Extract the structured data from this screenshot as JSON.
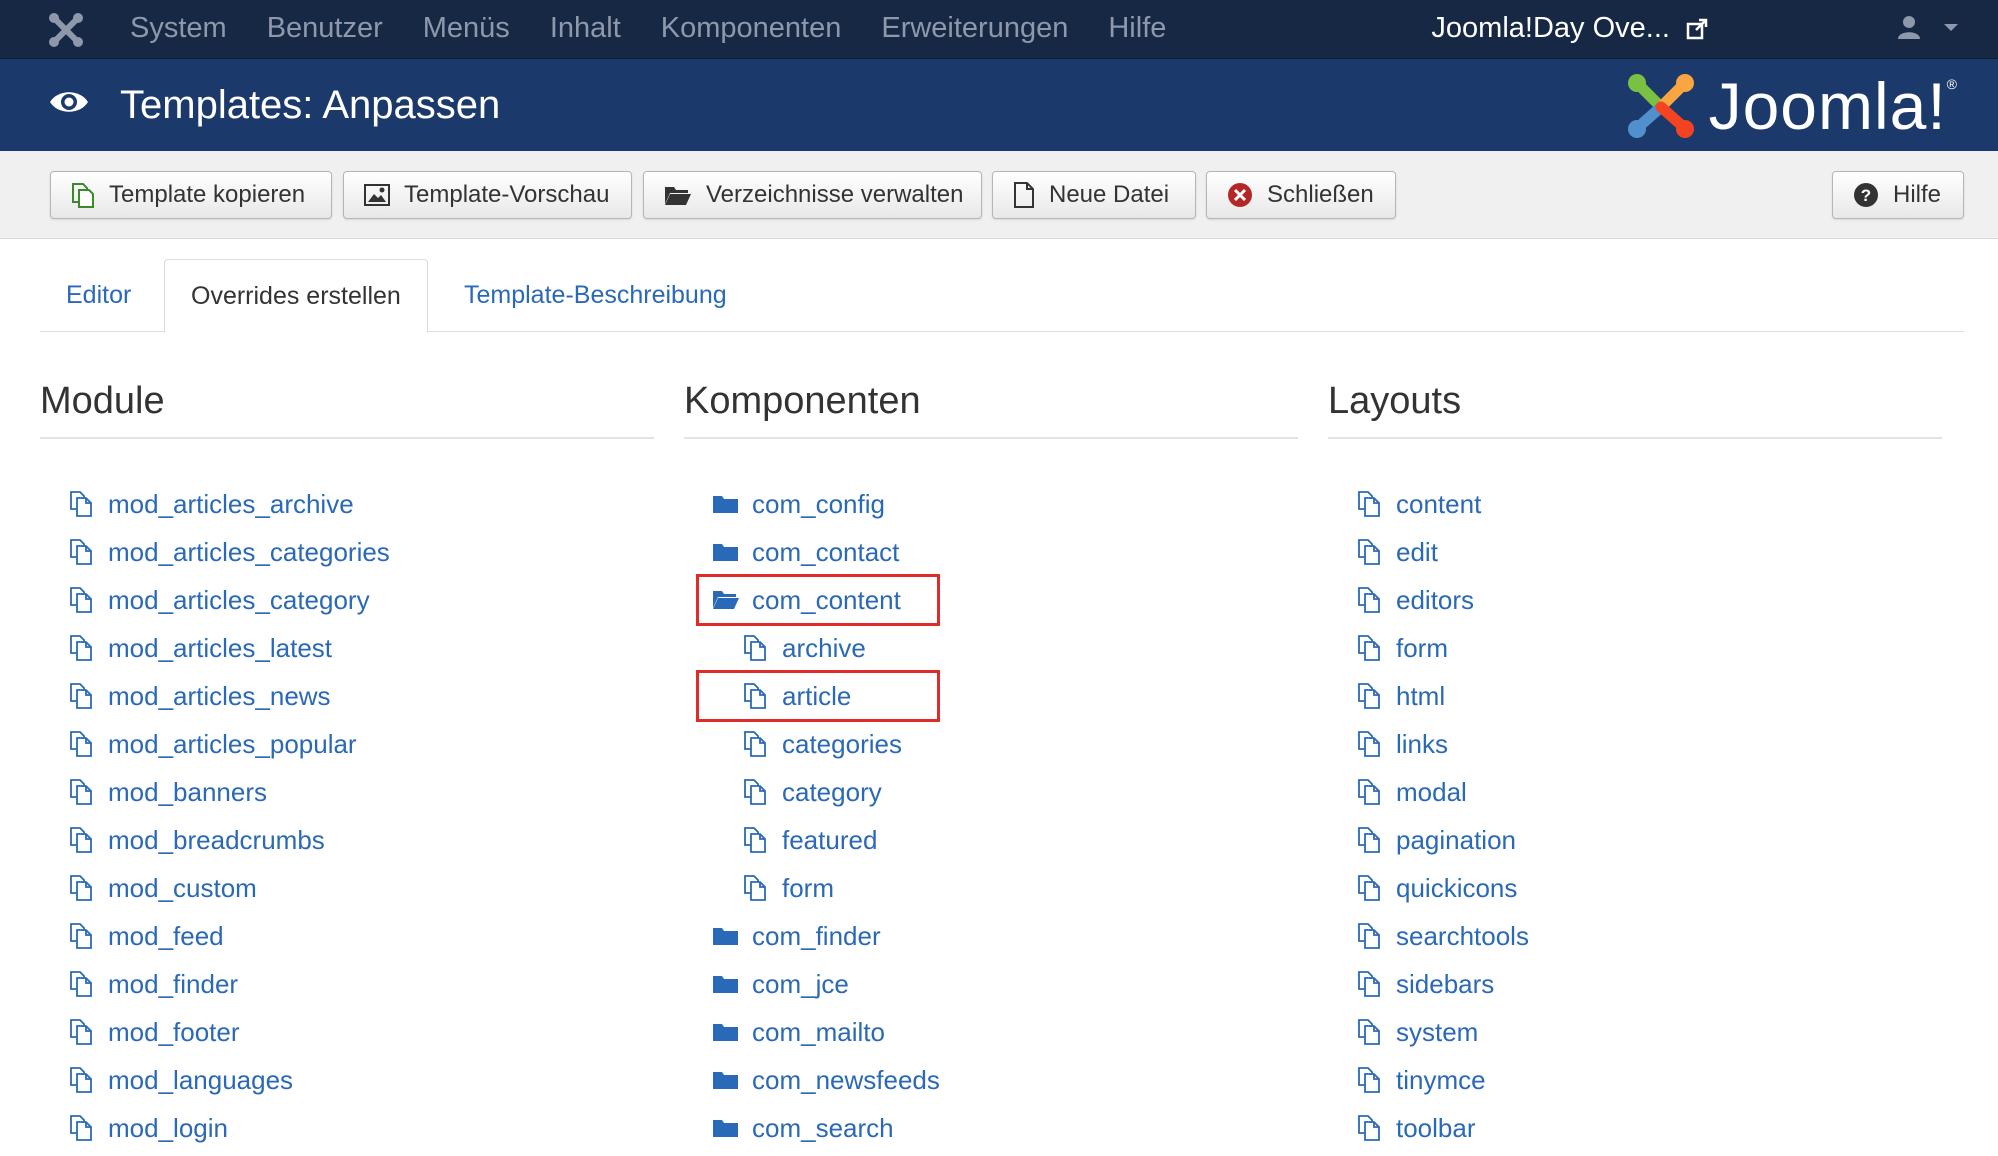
{
  "navbar": {
    "brand_icon": "joomla-icon",
    "menu": [
      "System",
      "Benutzer",
      "Menüs",
      "Inhalt",
      "Komponenten",
      "Erweiterungen",
      "Hilfe"
    ],
    "site_link": "Joomla!Day Ove...",
    "site_link_icon": "external-link-icon",
    "user_icon": "user-icon"
  },
  "header": {
    "title": "Templates: Anpassen",
    "icon": "eye-icon",
    "logo_text": "Joomla!",
    "logo_mark": "®"
  },
  "toolbar": {
    "copy": "Template kopieren",
    "preview": "Template-Vorschau",
    "folders": "Verzeichnisse verwalten",
    "new_file": "Neue Datei",
    "close": "Schließen",
    "help": "Hilfe"
  },
  "tabs": [
    "Editor",
    "Overrides erstellen",
    "Template-Beschreibung"
  ],
  "active_tab": "Overrides erstellen",
  "modules": {
    "title": "Module",
    "items": [
      "mod_articles_archive",
      "mod_articles_categories",
      "mod_articles_category",
      "mod_articles_latest",
      "mod_articles_news",
      "mod_articles_popular",
      "mod_banners",
      "mod_breadcrumbs",
      "mod_custom",
      "mod_feed",
      "mod_finder",
      "mod_footer",
      "mod_languages",
      "mod_login"
    ]
  },
  "components": {
    "title": "Komponenten",
    "items": [
      {
        "label": "com_config",
        "type": "folder"
      },
      {
        "label": "com_contact",
        "type": "folder"
      },
      {
        "label": "com_content",
        "type": "folder-open",
        "highlighted": true
      },
      {
        "label": "archive",
        "type": "file",
        "sub": true
      },
      {
        "label": "article",
        "type": "file",
        "sub": true,
        "highlighted": true
      },
      {
        "label": "categories",
        "type": "file",
        "sub": true
      },
      {
        "label": "category",
        "type": "file",
        "sub": true
      },
      {
        "label": "featured",
        "type": "file",
        "sub": true
      },
      {
        "label": "form",
        "type": "file",
        "sub": true
      },
      {
        "label": "com_finder",
        "type": "folder"
      },
      {
        "label": "com_jce",
        "type": "folder"
      },
      {
        "label": "com_mailto",
        "type": "folder"
      },
      {
        "label": "com_newsfeeds",
        "type": "folder"
      },
      {
        "label": "com_search",
        "type": "folder"
      }
    ]
  },
  "layouts": {
    "title": "Layouts",
    "items": [
      "content",
      "edit",
      "editors",
      "form",
      "html",
      "links",
      "modal",
      "pagination",
      "quickicons",
      "searchtools",
      "sidebars",
      "system",
      "tinymce",
      "toolbar"
    ]
  },
  "colors": {
    "navbar_bg": "#172845",
    "header_bg": "#1b3a6b",
    "link": "#2a69b8",
    "highlight": "#e02b2b"
  }
}
